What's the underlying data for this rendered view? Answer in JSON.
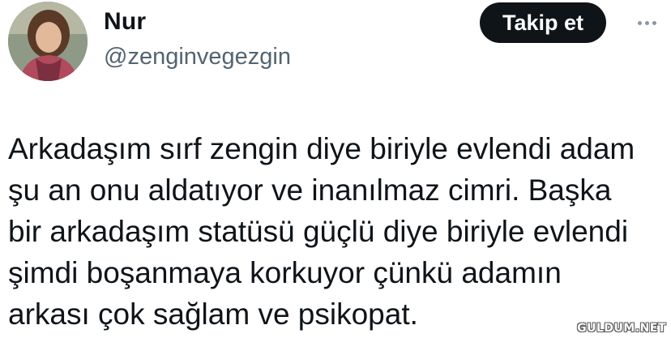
{
  "user": {
    "name": "Nur",
    "handle": "@zenginvegezgin"
  },
  "header": {
    "follow_label": "Takip et",
    "more_icon": "more-horizontal-icon"
  },
  "tweet": {
    "lines": [
      "Arkadaşım sırf zengin diye biriyle evlendi adam",
      "şu an onu aldatıyor ve inanılmaz cimri. Başka",
      "bir arkadaşım statüsü güçlü diye biriyle evlendi",
      "şimdi boşanmaya korkuyor çünkü adamın",
      "arkası çok sağlam ve psikopat."
    ]
  },
  "watermark": "GULDUM.NET",
  "colors": {
    "button_bg": "#0f1419",
    "handle": "#536471",
    "text": "#0f1419"
  }
}
